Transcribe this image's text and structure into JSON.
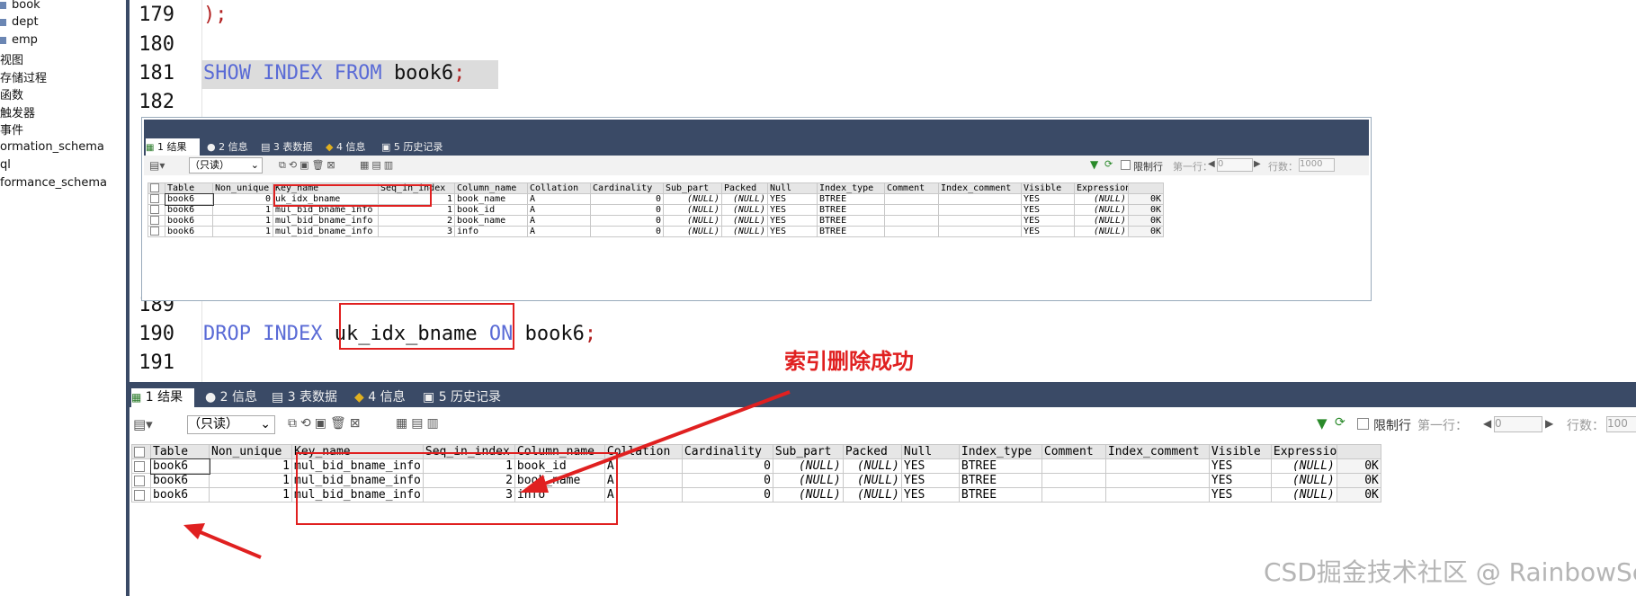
{
  "tree": {
    "items": [
      {
        "label": "book",
        "icon": "table-icon"
      },
      {
        "label": "dept",
        "icon": "table-icon"
      },
      {
        "label": "emp",
        "icon": "table-icon"
      },
      {
        "label": "视图",
        "icon": ""
      },
      {
        "label": "存储过程",
        "icon": ""
      },
      {
        "label": "函数",
        "icon": ""
      },
      {
        "label": "触发器",
        "icon": ""
      },
      {
        "label": "事件",
        "icon": ""
      },
      {
        "label": "ormation_schema",
        "icon": ""
      },
      {
        "label": "ql",
        "icon": ""
      },
      {
        "label": "formance_schema",
        "icon": ""
      }
    ]
  },
  "editor": {
    "lines": [
      {
        "num": "179",
        "code": ");"
      },
      {
        "num": "180",
        "code": ""
      },
      {
        "num": "181",
        "kw1": "SHOW INDEX FROM",
        "obj": "book6",
        "end": ";"
      },
      {
        "num": "182",
        "code": ""
      },
      {
        "num": "189",
        "code": ""
      },
      {
        "num": "190",
        "kw1": "DROP INDEX",
        "obj": "uk_idx_bname",
        "kw2": "ON",
        "obj2": "book6",
        "end": ";"
      },
      {
        "num": "191",
        "code": ""
      }
    ]
  },
  "annotation": {
    "text": "索引删除成功",
    "color": "#e02020"
  },
  "tabs": [
    {
      "label": "1 结果",
      "icon": "result-icon"
    },
    {
      "label": "2 信息",
      "icon": "info-icon"
    },
    {
      "label": "3 表数据",
      "icon": "table-data-icon"
    },
    {
      "label": "4 信息",
      "icon": "info2-icon"
    },
    {
      "label": "5 历史记录",
      "icon": "history-icon"
    }
  ],
  "toolbar": {
    "mode_select": "（只读）",
    "limit_label": "限制行",
    "first_row_label": "第一行：",
    "first_row_value": "0",
    "rows_label": "行数：",
    "rows_value_top": "1000",
    "rows_value_bottom": "100"
  },
  "columns": [
    "Table",
    "Non_unique",
    "Key_name",
    "Seq_in_index",
    "Column_name",
    "Collation",
    "Cardinality",
    "Sub_part",
    "Packed",
    "Null",
    "Index_type",
    "Comment",
    "Index_comment",
    "Visible",
    "Expression"
  ],
  "before_rows": [
    [
      "book6",
      "0",
      "uk_idx_bname",
      "1",
      "book_name",
      "A",
      "0",
      "(NULL)",
      "(NULL)",
      "YES",
      "BTREE",
      "",
      "",
      "YES",
      "(NULL)",
      "0K"
    ],
    [
      "book6",
      "1",
      "mul_bid_bname_info",
      "1",
      "book_id",
      "A",
      "0",
      "(NULL)",
      "(NULL)",
      "YES",
      "BTREE",
      "",
      "",
      "YES",
      "(NULL)",
      "0K"
    ],
    [
      "book6",
      "1",
      "mul_bid_bname_info",
      "2",
      "book_name",
      "A",
      "0",
      "(NULL)",
      "(NULL)",
      "YES",
      "BTREE",
      "",
      "",
      "YES",
      "(NULL)",
      "0K"
    ],
    [
      "book6",
      "1",
      "mul_bid_bname_info",
      "3",
      "info",
      "A",
      "0",
      "(NULL)",
      "(NULL)",
      "YES",
      "BTREE",
      "",
      "",
      "YES",
      "(NULL)",
      "0K"
    ]
  ],
  "after_rows": [
    [
      "book6",
      "1",
      "mul_bid_bname_info",
      "1",
      "book_id",
      "A",
      "0",
      "(NULL)",
      "(NULL)",
      "YES",
      "BTREE",
      "",
      "",
      "YES",
      "(NULL)",
      "0K"
    ],
    [
      "book6",
      "1",
      "mul_bid_bname_info",
      "2",
      "book_name",
      "A",
      "0",
      "(NULL)",
      "(NULL)",
      "YES",
      "BTREE",
      "",
      "",
      "YES",
      "(NULL)",
      "0K"
    ],
    [
      "book6",
      "1",
      "mul_bid_bname_info",
      "3",
      "info",
      "A",
      "0",
      "(NULL)",
      "(NULL)",
      "YES",
      "BTREE",
      "",
      "",
      "YES",
      "(NULL)",
      "0K"
    ]
  ],
  "watermark": "CSD掘金技术社区 @ RainbowSea",
  "colors": {
    "accent_red": "#e02020",
    "tab_bar": "#3a4a66",
    "keyword": "#5a6bd6"
  }
}
